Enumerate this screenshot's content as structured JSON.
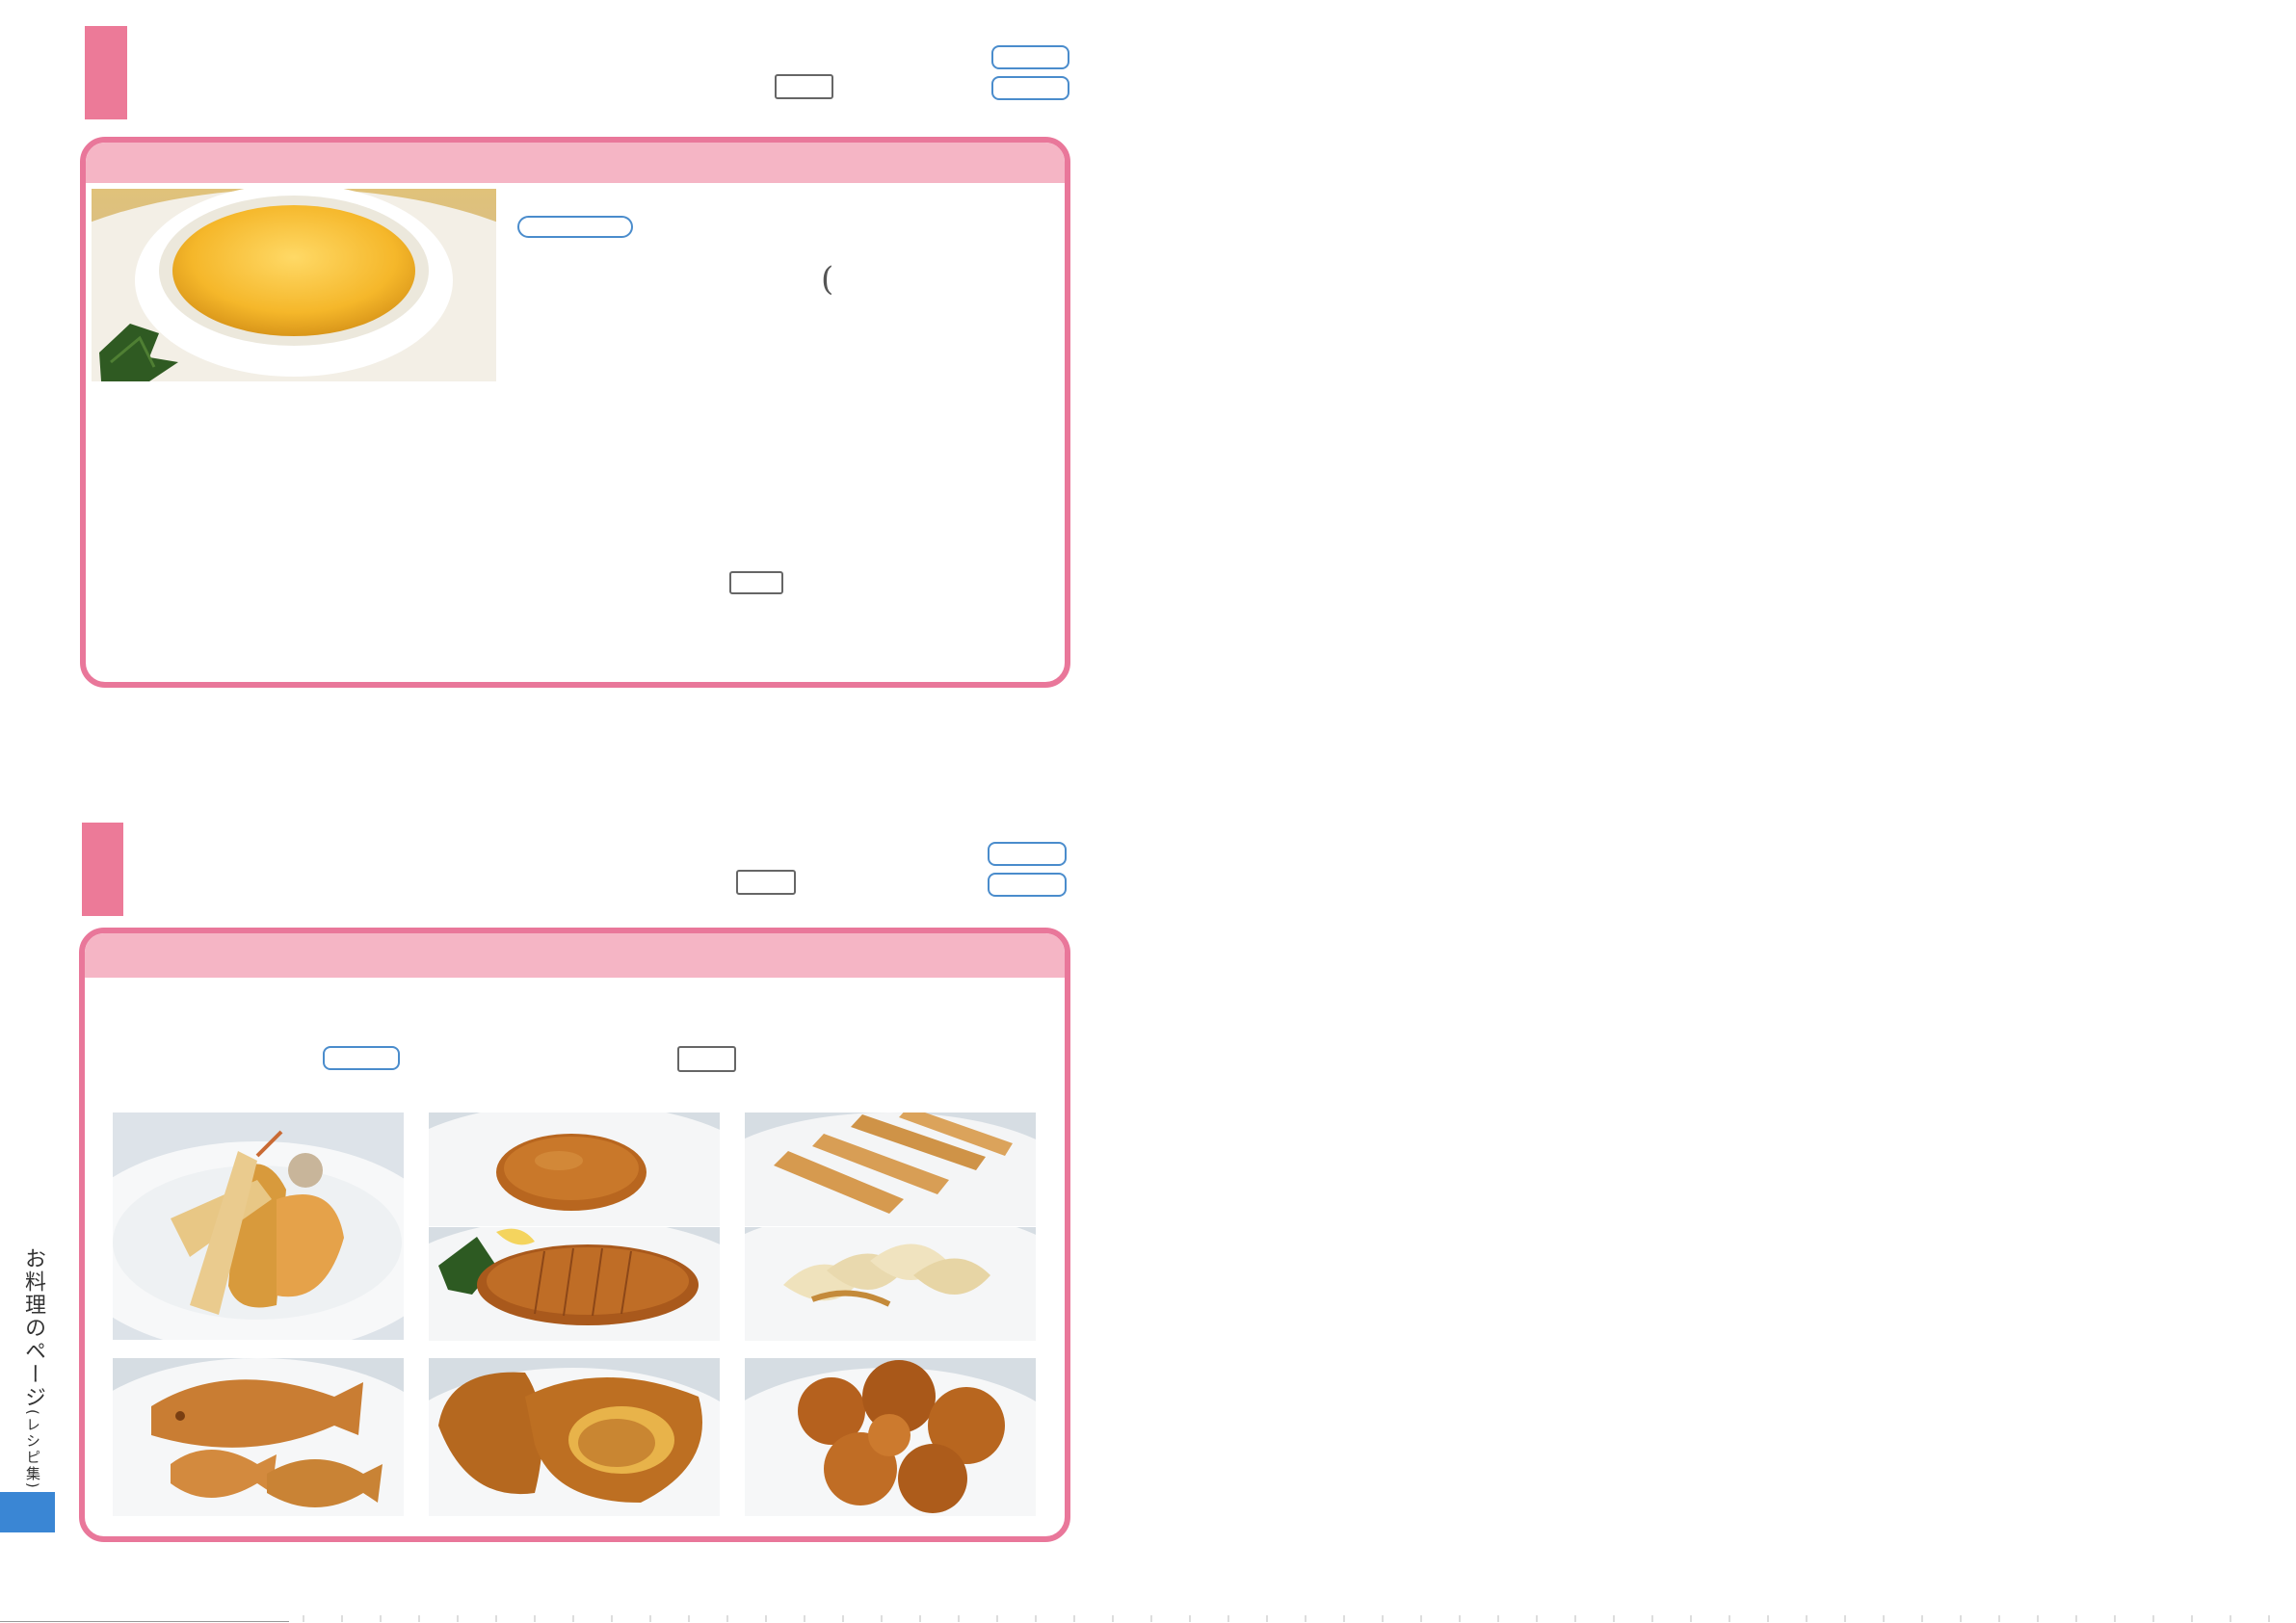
{
  "sidebar": {
    "label_main": "お料理のページ",
    "label_paren": "(レシピ集)",
    "accent_color": "#3a86d4"
  },
  "colors": {
    "section_tab": "#ec7a98",
    "panel_border": "#e9779a",
    "panel_header": "#f5b5c5",
    "outline_blue": "#4a8ccc"
  },
  "section1": {
    "paren_mark": "(",
    "photo": "custard-pudding-photo"
  },
  "section2": {
    "photos": [
      "tempura-photo",
      "croquette-photo",
      "spring-rolls-photo",
      "cutlet-photo",
      "gyoza-photo",
      "taiyaki-photo",
      "curry-bread-photo",
      "karaage-photo"
    ]
  }
}
